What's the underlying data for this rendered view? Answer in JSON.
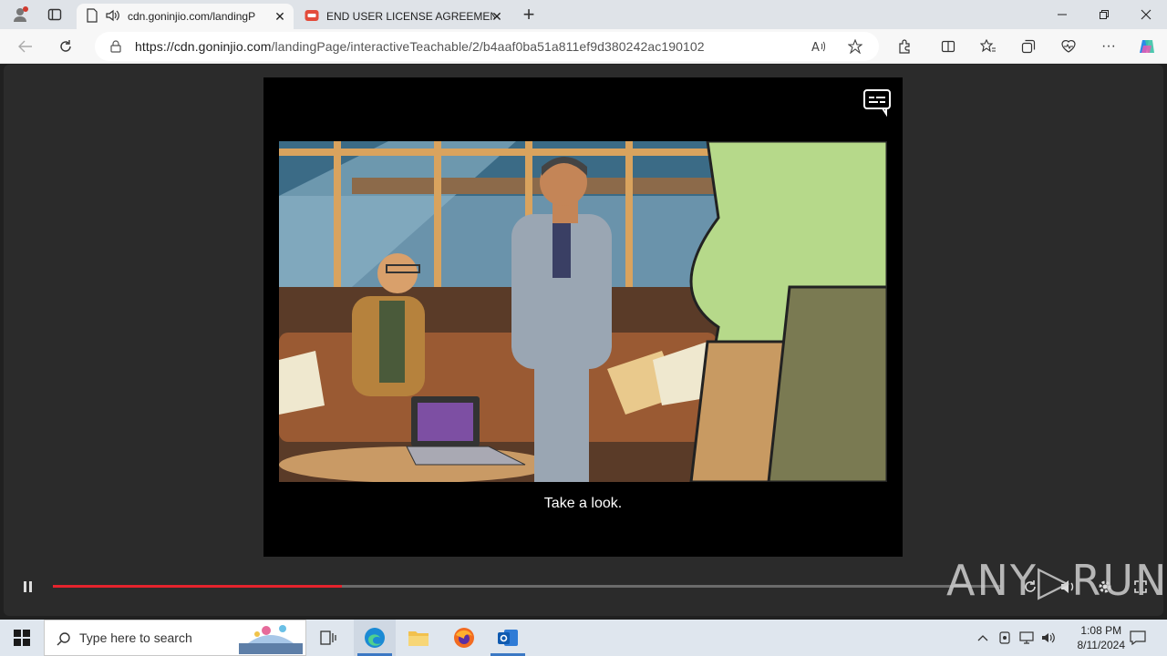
{
  "browser": {
    "tabs": [
      {
        "title": "cdn.goninjio.com/landingP",
        "active": true
      },
      {
        "title": "END USER LICENSE AGREEMENT",
        "active": false
      }
    ],
    "url_domain": "https://cdn.goninjio.com",
    "url_path": "/landingPage/interactiveTeachable/2/b4aaf0ba51a811ef9d380242ac190102",
    "new_tab_label": "+"
  },
  "player": {
    "caption": "Take a look.",
    "progress": 0.305,
    "progress_color": "#e5232d"
  },
  "watermark": "ANY▷RUN",
  "taskbar": {
    "search_placeholder": "Type here to search",
    "time": "1:08 PM",
    "date": "8/11/2024"
  }
}
